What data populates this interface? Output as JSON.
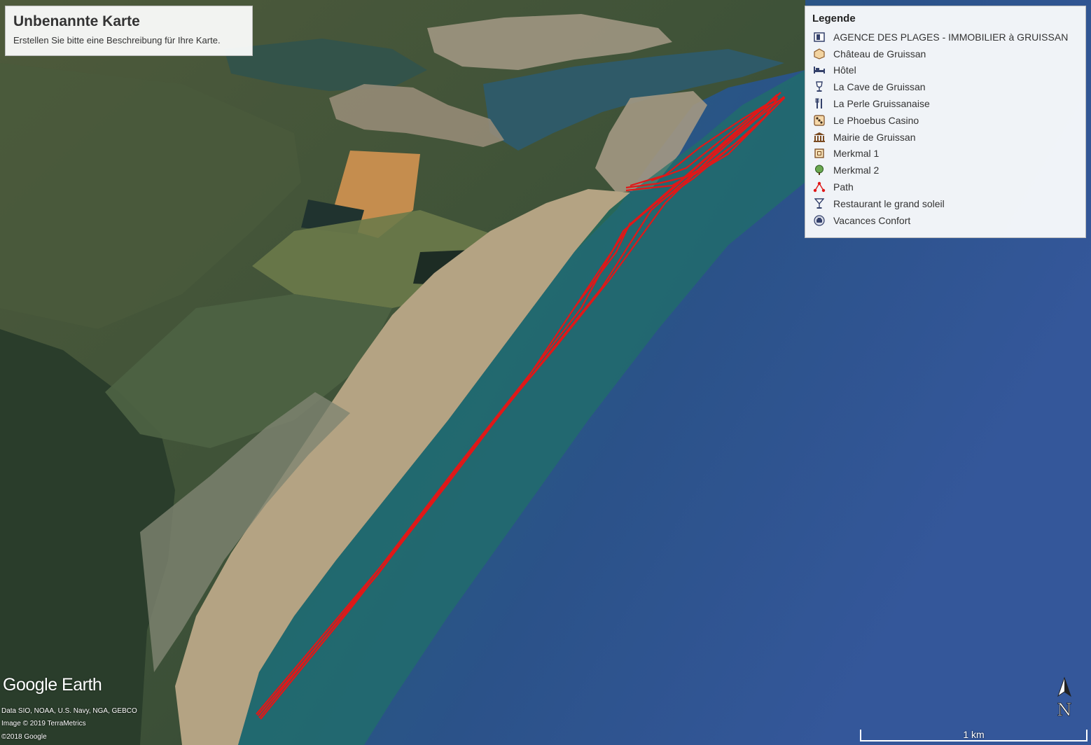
{
  "map": {
    "title": "Unbenannte Karte",
    "description": "Erstellen Sie bitte eine Beschreibung für Ihre Karte."
  },
  "legend": {
    "title": "Legende",
    "items": [
      {
        "label": "AGENCE DES PLAGES - IMMOBILIER à GRUISSAN",
        "icon": "real-estate-icon"
      },
      {
        "label": "Château de Gruissan",
        "icon": "castle-icon"
      },
      {
        "label": "Hôtel",
        "icon": "hotel-bed-icon"
      },
      {
        "label": "La Cave de Gruissan",
        "icon": "wine-glass-icon"
      },
      {
        "label": "La Perle Gruissanaise",
        "icon": "restaurant-cutlery-icon"
      },
      {
        "label": "Le Phoebus Casino",
        "icon": "dice-icon"
      },
      {
        "label": "Mairie de Gruissan",
        "icon": "town-hall-icon"
      },
      {
        "label": "Merkmal 1",
        "icon": "square-marker-icon"
      },
      {
        "label": "Merkmal 2",
        "icon": "tree-icon"
      },
      {
        "label": "Path",
        "icon": "path-icon"
      },
      {
        "label": "Restaurant le grand soleil",
        "icon": "cocktail-icon"
      },
      {
        "label": "Vacances Confort",
        "icon": "car-icon"
      }
    ]
  },
  "branding": {
    "logo": "Google Earth"
  },
  "attribution": {
    "line1": "Data SIO, NOAA, U.S. Navy, NGA, GEBCO",
    "line2": "Image © 2019 TerraMetrics",
    "line3": "©2018 Google"
  },
  "compass": {
    "letter": "N"
  },
  "scale_bar": {
    "label": "1 km"
  },
  "colors": {
    "track": "#e01818",
    "sea_deep": "#2d4f8a",
    "sea_shallow": "#1d6a6a",
    "sand": "#b4a383"
  }
}
